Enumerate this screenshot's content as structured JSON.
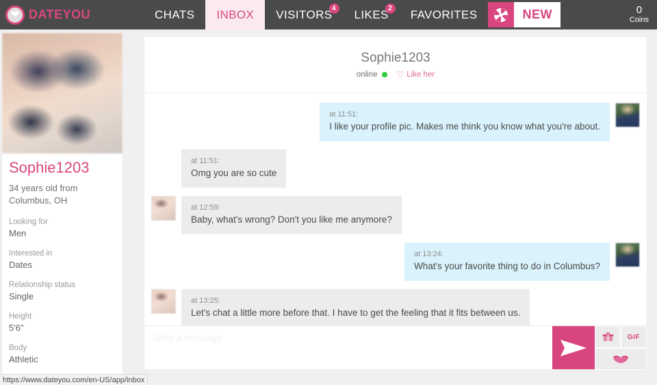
{
  "brand": {
    "name": "DATEYOU",
    "logo_icon": "heart-icon",
    "accent_color": "#d9467f"
  },
  "nav": {
    "tabs": [
      {
        "label": "CHATS",
        "badge": null,
        "active": false
      },
      {
        "label": "INBOX",
        "badge": null,
        "active": true
      },
      {
        "label": "VISITORS",
        "badge": "4",
        "active": false
      },
      {
        "label": "LIKES",
        "badge": "2",
        "active": false
      },
      {
        "label": "FAVORITES",
        "badge": null,
        "active": false
      }
    ],
    "new_button": {
      "label": "NEW",
      "icon": "pinwheel-icon"
    },
    "coins": {
      "count": "0",
      "label": "Coins"
    }
  },
  "sidebar": {
    "photo_alt": "profile-photo",
    "name": "Sophie1203",
    "subtitle": "34 years old from Columbus, OH",
    "attributes": [
      {
        "label": "Looking for",
        "value": "Men"
      },
      {
        "label": "Interested in",
        "value": "Dates"
      },
      {
        "label": "Relationship status",
        "value": "Single"
      },
      {
        "label": "Height",
        "value": "5'6\""
      },
      {
        "label": "Body",
        "value": "Athletic"
      }
    ]
  },
  "chat": {
    "title": "Sophie1203",
    "status": "online",
    "like_label": "Like her",
    "like_icon": "heart-outline-icon",
    "messages": [
      {
        "time": "at 11:51:",
        "text": "I like your profile pic. Makes me think you know what you're about.",
        "direction": "out"
      },
      {
        "time": "at 11:51:",
        "text": "Omg you are so cute",
        "direction": "in",
        "avatar": false
      },
      {
        "time": "at 12:59:",
        "text": "Baby, what's wrong? Don't you like me anymore?",
        "direction": "in",
        "avatar": true
      },
      {
        "time": "at 13:24:",
        "text": "What's your favorite thing to do in Columbus?",
        "direction": "out"
      },
      {
        "time": "at 13:25:",
        "text": "Let's chat a little more before that. I have to get the feeling that it fits between us.",
        "direction": "in",
        "avatar": true
      }
    ],
    "composer": {
      "value": "",
      "placeholder": "Write a message",
      "send_icon": "send-paper-plane-icon",
      "gift_icon": "gift-icon",
      "gif_label": "GIF",
      "kiss_icon": "lips-kiss-icon"
    }
  },
  "statusbar": {
    "url": "https://www.dateyou.com/en-US/app/inbox"
  }
}
